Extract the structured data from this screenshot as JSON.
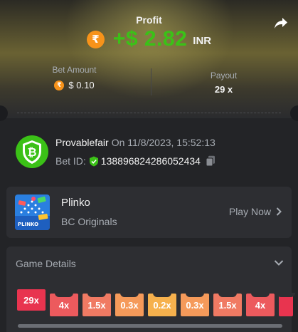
{
  "profit": {
    "label": "Profit",
    "coin_symbol": "₹",
    "amount": "+$ 2.82",
    "currency": "INR",
    "color": "#3bc117"
  },
  "stats": {
    "bet_amount_label": "Bet Amount",
    "bet_amount_value": "$ 0.10",
    "payout_label": "Payout",
    "payout_value": "29 x"
  },
  "provable": {
    "name": "Provablefair",
    "date": "On 11/8/2023, 15:52:13",
    "bet_id_label": "Bet ID:",
    "bet_id": "138896824286052434"
  },
  "game": {
    "title": "Plinko",
    "provider": "BC Originals",
    "play_label": "Play Now",
    "thumb_text": "PLINKO"
  },
  "details": {
    "title": "Game Details",
    "multipliers": [
      {
        "label": "29x",
        "color": "#e8344f",
        "active": true
      },
      {
        "label": "4x",
        "color": "#ec5a5d",
        "active": false
      },
      {
        "label": "1.5x",
        "color": "#f07a63",
        "active": false
      },
      {
        "label": "0.3x",
        "color": "#f59a5a",
        "active": false
      },
      {
        "label": "0.2x",
        "color": "#f6b14d",
        "active": false
      },
      {
        "label": "0.3x",
        "color": "#f59a5a",
        "active": false
      },
      {
        "label": "1.5x",
        "color": "#f07a63",
        "active": false
      },
      {
        "label": "4x",
        "color": "#ec5a5d",
        "active": false
      },
      {
        "label": "",
        "color": "#e8344f",
        "active": false
      }
    ]
  },
  "icons": {
    "share": "share-icon",
    "shield": "shield-bitcoin-icon",
    "verified": "verified-shield-icon",
    "copy": "copy-icon",
    "chevron_right": "chevron-right-icon",
    "chevron_down": "chevron-down-icon"
  }
}
